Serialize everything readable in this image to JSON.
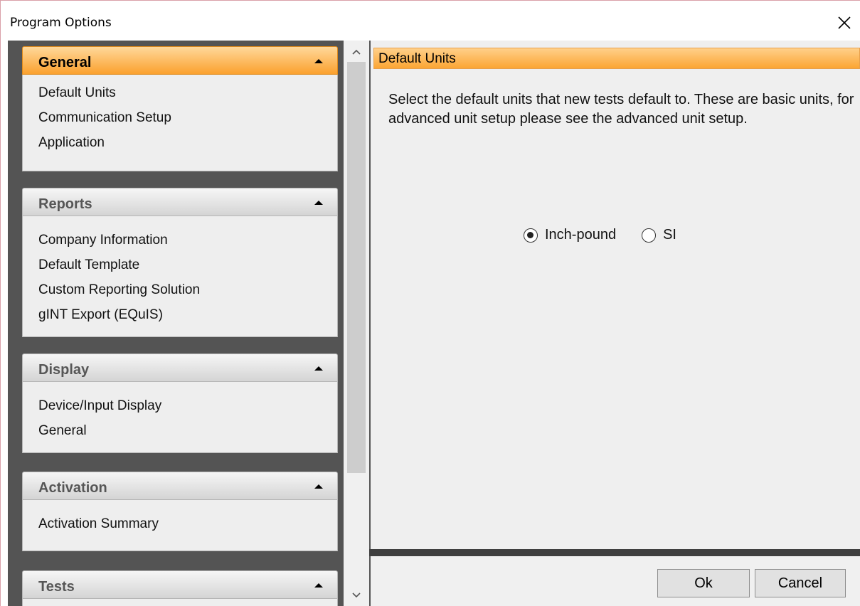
{
  "window": {
    "title": "Program Options"
  },
  "sidebar": {
    "groups": [
      {
        "title": "General",
        "active": true,
        "items": [
          "Default Units",
          "Communication Setup",
          "Application"
        ]
      },
      {
        "title": "Reports",
        "active": false,
        "items": [
          "Company Information",
          "Default Template",
          "Custom Reporting Solution",
          "gINT Export (EQuIS)"
        ]
      },
      {
        "title": "Display",
        "active": false,
        "items": [
          "Device/Input Display",
          "General"
        ]
      },
      {
        "title": "Activation",
        "active": false,
        "items": [
          "Activation Summary"
        ]
      },
      {
        "title": "Tests",
        "active": false,
        "items": []
      }
    ]
  },
  "main": {
    "section_title": "Default Units",
    "description": "Select the default units that new tests default to.  These are basic units, for advanced unit setup please see the advanced unit setup.",
    "units": {
      "options": [
        "Inch-pound",
        "SI"
      ],
      "selected": "Inch-pound"
    }
  },
  "footer": {
    "ok_label": "Ok",
    "cancel_label": "Cancel"
  },
  "colors": {
    "active_header": "#fba12e",
    "sidebar_bg": "#545454",
    "panel_bg": "#efefef"
  }
}
